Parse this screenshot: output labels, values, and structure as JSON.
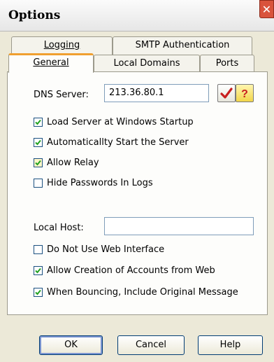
{
  "window": {
    "title": "Options",
    "close_glyph": "✕"
  },
  "tabs": {
    "back_row": [
      {
        "label": "Logging"
      },
      {
        "label": "SMTP Authentication"
      }
    ],
    "front_row": [
      {
        "label": "General",
        "selected": true
      },
      {
        "label": "Local Domains"
      },
      {
        "label": "Ports"
      }
    ]
  },
  "general": {
    "dns_label": "DNS Server:",
    "dns_value": "213.36.80.1",
    "check_icon": "checkmark-icon",
    "help_icon": "question-icon",
    "checkboxes_top": [
      {
        "label": "Load Server at Windows Startup",
        "checked": true
      },
      {
        "label": "Automaticallty Start the Server",
        "checked": true
      },
      {
        "label": "Allow Relay",
        "checked": true
      },
      {
        "label": "Hide Passwords In Logs",
        "checked": false
      }
    ],
    "localhost_label": "Local Host:",
    "localhost_value": "",
    "checkboxes_bottom": [
      {
        "label": "Do Not Use Web Interface",
        "checked": false
      },
      {
        "label": "Allow Creation of Accounts from Web",
        "checked": true
      },
      {
        "label": "When Bouncing, Include Original Message",
        "checked": true
      }
    ]
  },
  "buttons": {
    "ok": "OK",
    "cancel": "Cancel",
    "help": "Help"
  },
  "colors": {
    "accent_tab": "#f0a030",
    "check_green": "#21a121",
    "close_red": "#d9533c"
  }
}
